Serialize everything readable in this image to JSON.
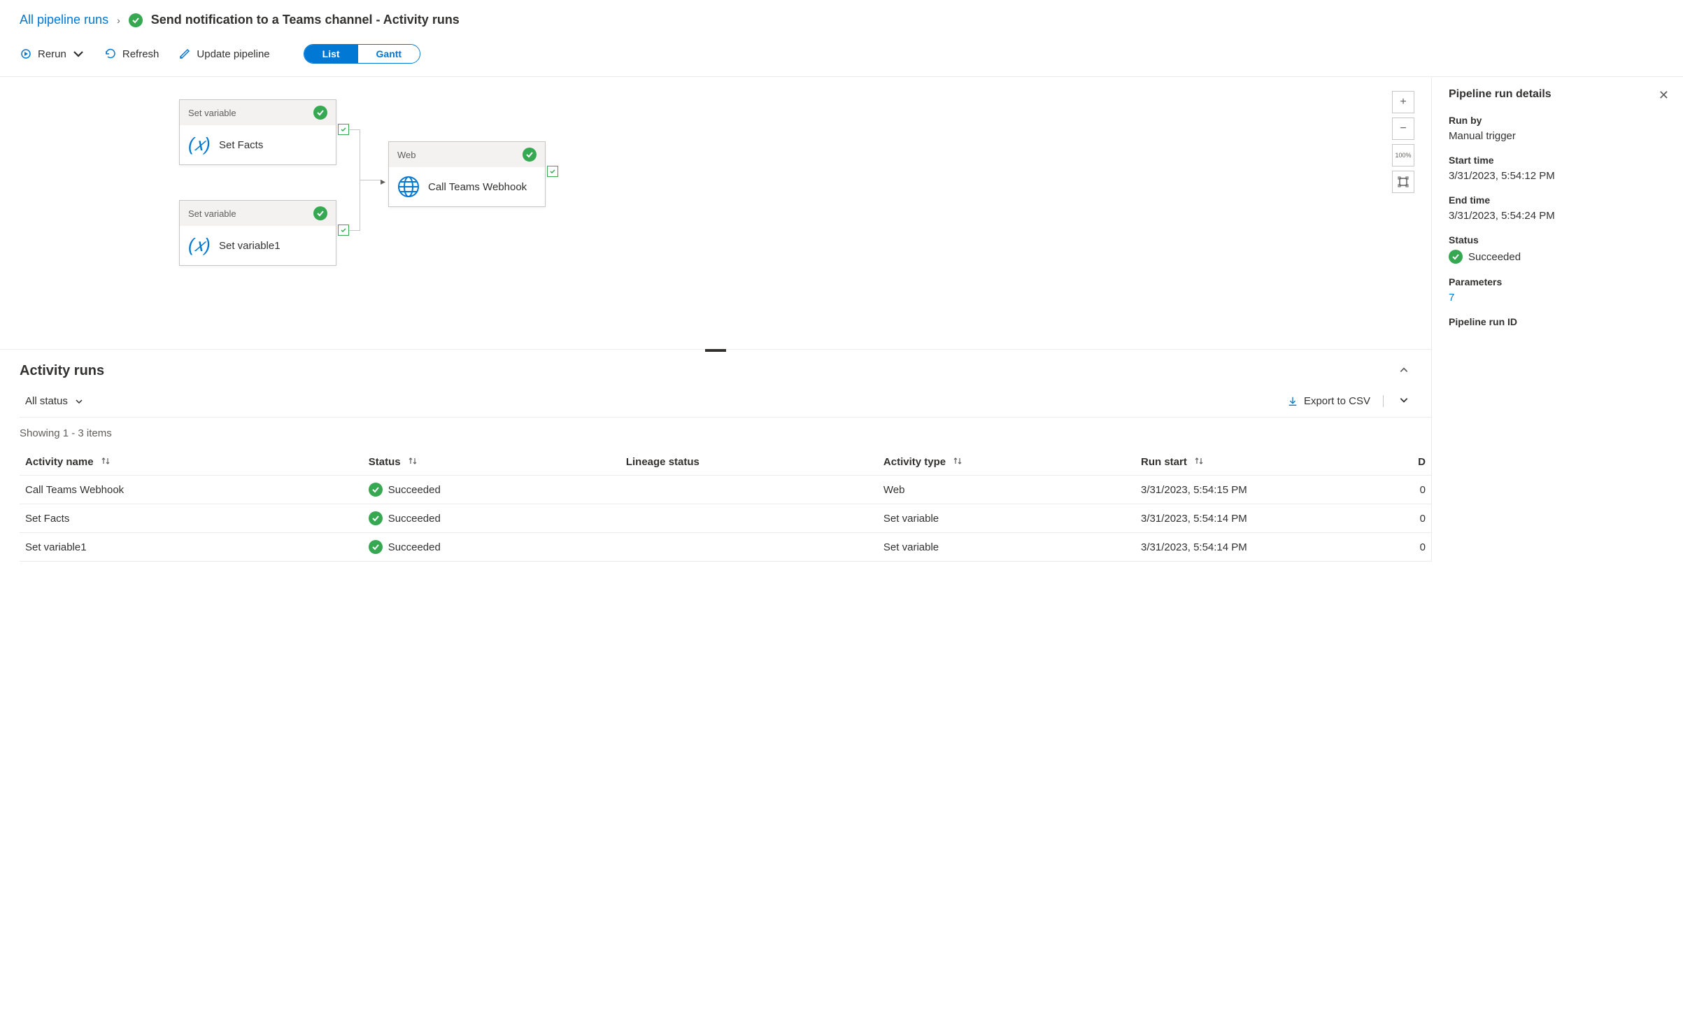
{
  "breadcrumb": {
    "root": "All pipeline runs",
    "title": "Send notification to a Teams channel - Activity runs"
  },
  "toolbar": {
    "rerun": "Rerun",
    "refresh": "Refresh",
    "update": "Update pipeline",
    "view_list": "List",
    "view_gantt": "Gantt"
  },
  "canvas": {
    "node1_header": "Set variable",
    "node1_name": "Set Facts",
    "node2_header": "Set variable",
    "node2_name": "Set variable1",
    "node3_header": "Web",
    "node3_name": "Call Teams Webhook",
    "zoom_label": "100%"
  },
  "activity": {
    "title": "Activity runs",
    "filter": "All status",
    "export": "Export to CSV",
    "showing": "Showing 1 - 3 items",
    "cols": {
      "name": "Activity name",
      "status": "Status",
      "lineage": "Lineage status",
      "type": "Activity type",
      "start": "Run start",
      "dur": "D"
    },
    "rows": [
      {
        "name": "Call Teams Webhook",
        "status": "Succeeded",
        "type": "Web",
        "start": "3/31/2023, 5:54:15 PM",
        "dur": "0"
      },
      {
        "name": "Set Facts",
        "status": "Succeeded",
        "type": "Set variable",
        "start": "3/31/2023, 5:54:14 PM",
        "dur": "0"
      },
      {
        "name": "Set variable1",
        "status": "Succeeded",
        "type": "Set variable",
        "start": "3/31/2023, 5:54:14 PM",
        "dur": "0"
      }
    ]
  },
  "details": {
    "title": "Pipeline run details",
    "runby_l": "Run by",
    "runby_v": "Manual trigger",
    "start_l": "Start time",
    "start_v": "3/31/2023, 5:54:12 PM",
    "end_l": "End time",
    "end_v": "3/31/2023, 5:54:24 PM",
    "status_l": "Status",
    "status_v": "Succeeded",
    "params_l": "Parameters",
    "params_v": "7",
    "runid_l": "Pipeline run ID"
  }
}
